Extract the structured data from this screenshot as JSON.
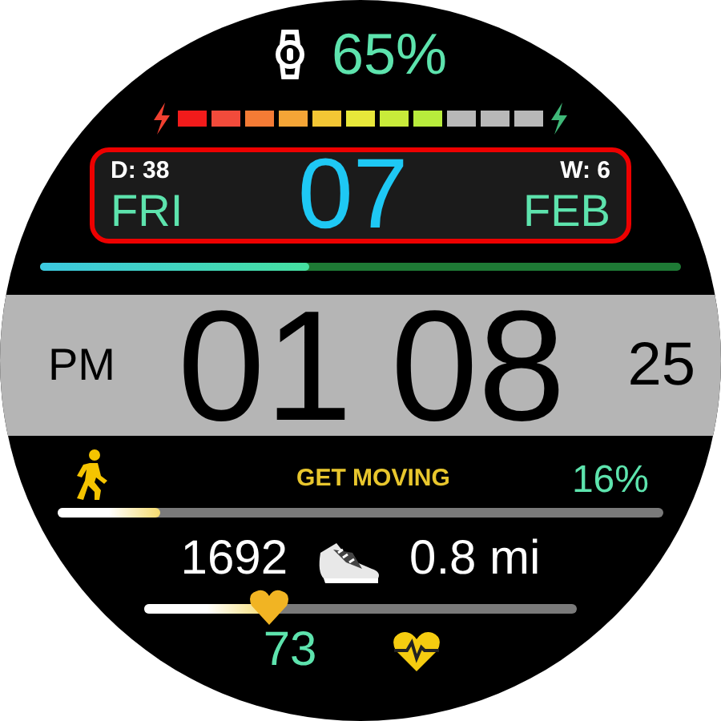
{
  "watch_battery": {
    "reading": "65%",
    "level": 0.73
  },
  "date": {
    "day_of_year": "D: 38",
    "weekday": "FRI",
    "day": "07",
    "week": "W: 6",
    "month": "FEB"
  },
  "day_progress": {
    "level": 0.42
  },
  "time": {
    "ampm": "PM",
    "hours": "01",
    "minutes": "08",
    "seconds": "25"
  },
  "activity": {
    "label": "GET MOVING",
    "reading": "16%",
    "level": 0.17
  },
  "steps": {
    "count": "1692",
    "distance": "0.8 mi"
  },
  "heart_rate": {
    "reading": "73",
    "level": 0.29
  }
}
